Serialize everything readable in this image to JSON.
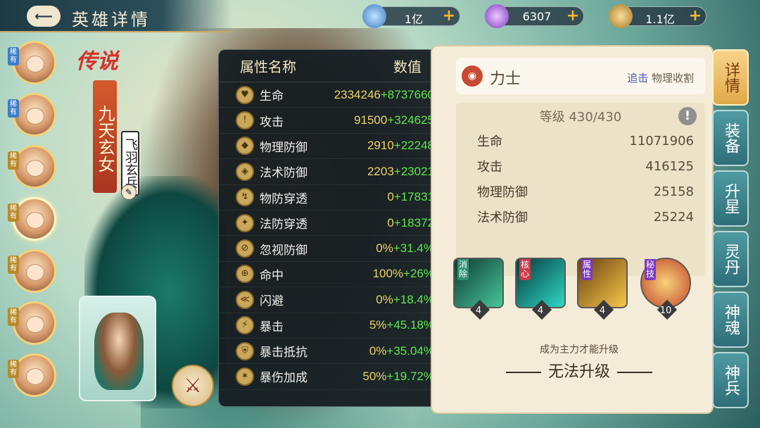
{
  "header": {
    "title": "英雄详情",
    "back_label": "⟵"
  },
  "resources": [
    {
      "name": "silver-icon",
      "value": "1亿",
      "color": "#5aa0e0"
    },
    {
      "name": "gem-icon",
      "value": "6307",
      "color": "#a066d8"
    },
    {
      "name": "coin-icon",
      "value": "1.1亿",
      "color": "#c89a3a"
    }
  ],
  "roster": [
    {
      "tag": "稀有",
      "type": "legend"
    },
    {
      "tag": "稀有",
      "type": "legend"
    },
    {
      "tag": "稀有",
      "type": "rare"
    },
    {
      "tag": "稀有",
      "type": "rare",
      "selected": true
    },
    {
      "tag": "稀有",
      "type": "rare"
    },
    {
      "tag": "稀有",
      "type": "rare"
    },
    {
      "tag": "稀有",
      "type": "rare"
    }
  ],
  "hero": {
    "rarity": "传说",
    "name": "九天玄女",
    "title": "飞羽玄兵"
  },
  "attributes": {
    "header_name": "属性名称",
    "header_value": "数值",
    "rows": [
      {
        "name": "生命",
        "base": "2334246",
        "bonus": "+8737660",
        "icon": "heart-icon"
      },
      {
        "name": "攻击",
        "base": "91500",
        "bonus": "+324625",
        "icon": "sword-icon"
      },
      {
        "name": "物理防御",
        "base": "2910",
        "bonus": "+22248",
        "icon": "shield-icon"
      },
      {
        "name": "法术防御",
        "base": "2203",
        "bonus": "+23021",
        "icon": "magic-shield-icon"
      },
      {
        "name": "物防穿透",
        "base": "0",
        "bonus": "+17831",
        "icon": "pierce-icon"
      },
      {
        "name": "法防穿透",
        "base": "0",
        "bonus": "+18372",
        "icon": "magic-pierce-icon"
      },
      {
        "name": "忽视防御",
        "base": "0%",
        "bonus": "+31.4%",
        "icon": "ignore-defense-icon"
      },
      {
        "name": "命中",
        "base": "100%",
        "bonus": "+26%",
        "icon": "target-icon"
      },
      {
        "name": "闪避",
        "base": "0%",
        "bonus": "+18.4%",
        "icon": "dodge-icon"
      },
      {
        "name": "暴击",
        "base": "5%",
        "bonus": "+45.18%",
        "icon": "crit-icon"
      },
      {
        "name": "暴击抵抗",
        "base": "0%",
        "bonus": "+35.04%",
        "icon": "crit-resist-icon"
      },
      {
        "name": "暴伤加成",
        "base": "50%",
        "bonus": "+19.72%",
        "icon": "crit-damage-icon"
      }
    ]
  },
  "detail": {
    "class_name": "力士",
    "tag_highlight": "追击",
    "tag_other": "物理收割",
    "level": "等级 430/430",
    "stats": [
      {
        "name": "生命",
        "value": "11071906"
      },
      {
        "name": "攻击",
        "value": "416125"
      },
      {
        "name": "物理防御",
        "value": "25158"
      },
      {
        "name": "法术防御",
        "value": "25224"
      }
    ],
    "skills": [
      {
        "tag": "消除",
        "level": "4",
        "color": "#2f8f6f"
      },
      {
        "tag": "核心",
        "level": "4",
        "color": "#1f8c8c"
      },
      {
        "tag": "属性",
        "level": "4",
        "color": "#d49a2a"
      },
      {
        "tag": "秘技",
        "level": "10",
        "color": "#c46a2a"
      }
    ],
    "upgrade_hint": "成为主力才能升级",
    "upgrade_status": "无法升级"
  },
  "tabs": [
    "详情",
    "装备",
    "升星",
    "灵丹",
    "神魂",
    "神兵"
  ]
}
